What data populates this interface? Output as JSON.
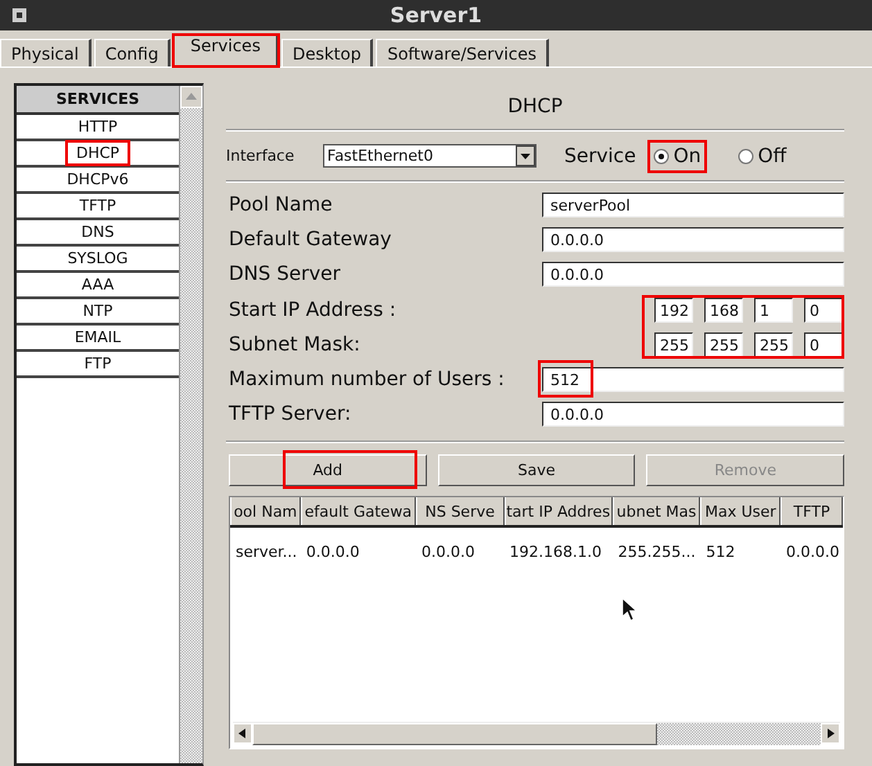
{
  "window": {
    "title": "Server1"
  },
  "tabs": [
    {
      "label": "Physical",
      "selected": false,
      "highlighted": false
    },
    {
      "label": "Config",
      "selected": false,
      "highlighted": false
    },
    {
      "label": "Services",
      "selected": true,
      "highlighted": true
    },
    {
      "label": "Desktop",
      "selected": false,
      "highlighted": false
    },
    {
      "label": "Software/Services",
      "selected": false,
      "highlighted": false
    }
  ],
  "services": {
    "heading": "SERVICES",
    "items": [
      {
        "label": "HTTP",
        "highlighted": false
      },
      {
        "label": "DHCP",
        "highlighted": true
      },
      {
        "label": "DHCPv6",
        "highlighted": false
      },
      {
        "label": "TFTP",
        "highlighted": false
      },
      {
        "label": "DNS",
        "highlighted": false
      },
      {
        "label": "SYSLOG",
        "highlighted": false
      },
      {
        "label": "AAA",
        "highlighted": false
      },
      {
        "label": "NTP",
        "highlighted": false
      },
      {
        "label": "EMAIL",
        "highlighted": false
      },
      {
        "label": "FTP",
        "highlighted": false
      }
    ]
  },
  "dhcp": {
    "title": "DHCP",
    "interface_label": "Interface",
    "interface": "FastEthernet0",
    "service_label": "Service",
    "service_options": [
      {
        "label": "On",
        "selected": true,
        "highlighted": true
      },
      {
        "label": "Off",
        "selected": false,
        "highlighted": false
      }
    ],
    "octets_highlighted": true,
    "fields": [
      {
        "kind": "text",
        "label": "Pool Name",
        "value": "serverPool",
        "highlighted": false
      },
      {
        "kind": "text",
        "label": "Default Gateway",
        "value": "0.0.0.0",
        "highlighted": false
      },
      {
        "kind": "text",
        "label": "DNS Server",
        "value": "0.0.0.0",
        "highlighted": false
      },
      {
        "kind": "octets",
        "label": "Start IP Address :",
        "octets": [
          "192",
          "168",
          "1",
          "0"
        ]
      },
      {
        "kind": "octets",
        "label": "Subnet Mask:",
        "octets": [
          "255",
          "255",
          "255",
          "0"
        ]
      },
      {
        "kind": "text",
        "label": "Maximum number of Users :",
        "value": "512",
        "highlighted": true
      },
      {
        "kind": "text",
        "label": "TFTP Server:",
        "value": "0.0.0.0",
        "highlighted": false
      }
    ],
    "buttons": [
      {
        "label": "Add",
        "disabled": false,
        "highlighted": true
      },
      {
        "label": "Save",
        "disabled": false,
        "highlighted": false
      },
      {
        "label": "Remove",
        "disabled": true,
        "highlighted": false
      }
    ],
    "table": {
      "columns": [
        "ool Nam",
        "efault Gatewa",
        "NS Serve",
        "tart IP Addres",
        "ubnet Mas",
        "Max User",
        "TFTP"
      ],
      "rows": [
        [
          "server...",
          "0.0.0.0",
          "0.0.0.0",
          "192.168.1.0",
          "255.255...",
          "512",
          "0.0.0.0"
        ]
      ]
    }
  }
}
